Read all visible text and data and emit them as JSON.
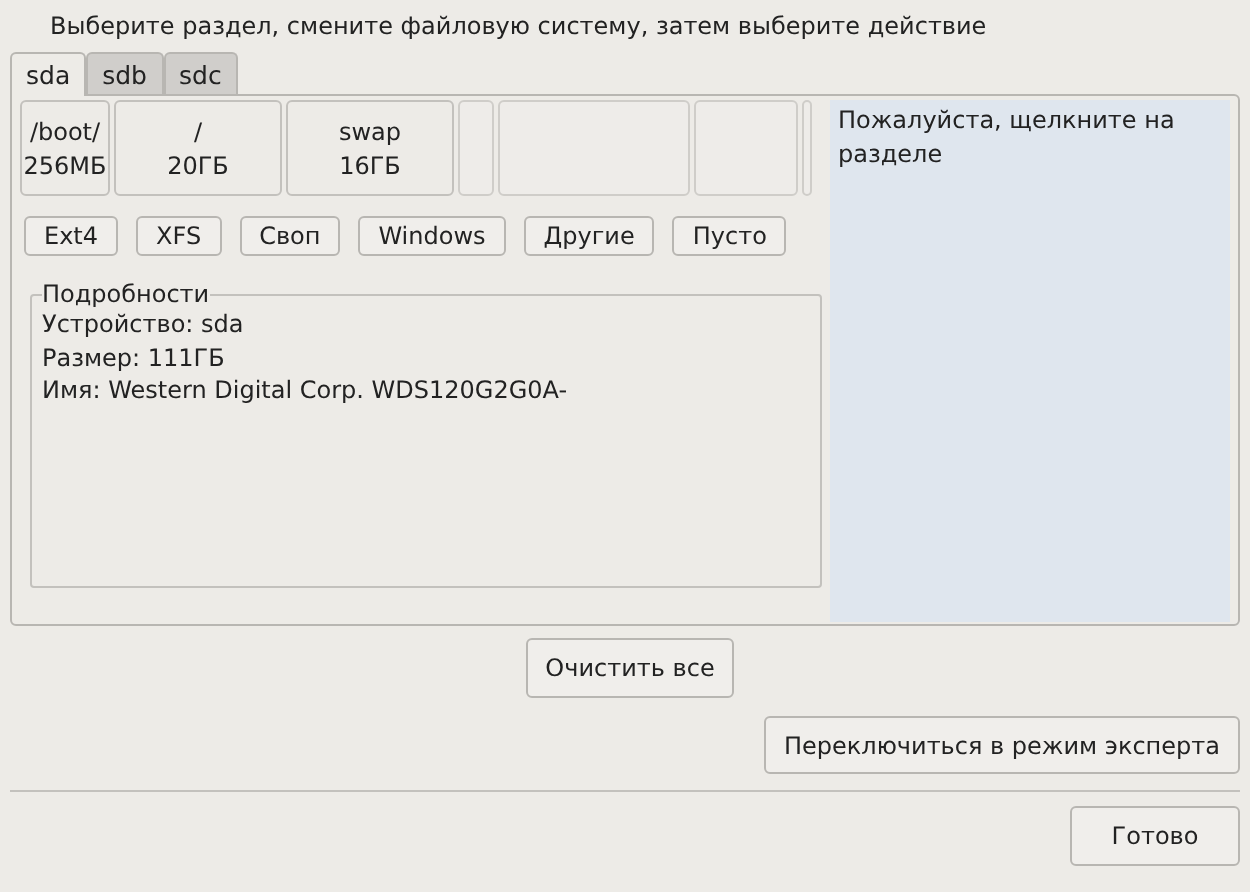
{
  "instruction": "Выберите раздел, смените файловую систему, затем выберите действие",
  "tabs": [
    {
      "label": "sda",
      "selected": true
    },
    {
      "label": "sdb",
      "selected": false
    },
    {
      "label": "sdc",
      "selected": false
    }
  ],
  "partitions": [
    {
      "kind": "used",
      "mount": "/boot/",
      "size": "256МБ"
    },
    {
      "kind": "used",
      "mount": "/",
      "size": "20ГБ"
    },
    {
      "kind": "used",
      "mount": "swap",
      "size": "16ГБ"
    },
    {
      "kind": "empty"
    },
    {
      "kind": "empty"
    },
    {
      "kind": "empty"
    },
    {
      "kind": "empty"
    }
  ],
  "filesystem_buttons": [
    "Ext4",
    "XFS",
    "Своп",
    "Windows",
    "Другие",
    "Пусто"
  ],
  "details": {
    "title": "Подробности",
    "lines": [
      "Устройство: sda",
      "Размер: 111ГБ",
      "Имя: Western Digital Corp. WDS120G2G0A-"
    ]
  },
  "info_panel": {
    "text": "Пожалуйста, щелкните на разделе"
  },
  "clear_button": "Очистить все",
  "expert_button": "Переключиться в режим эксперта",
  "done_button": "Готово"
}
